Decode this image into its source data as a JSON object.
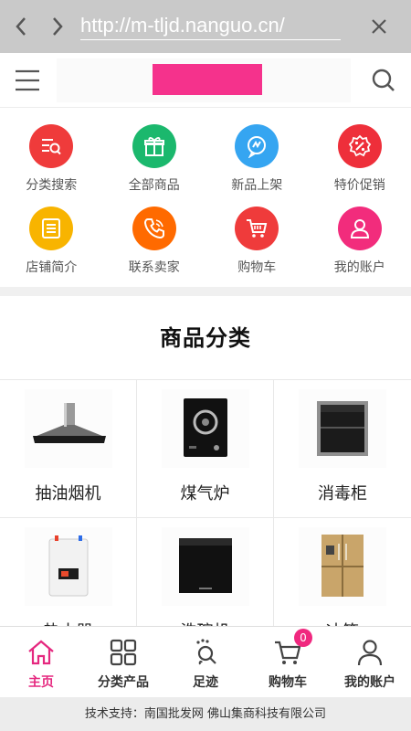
{
  "browser": {
    "url": "http://m-tljd.nanguo.cn/"
  },
  "header": {
    "logo_color": "#f5328c"
  },
  "quick_links": [
    {
      "label": "分类搜索",
      "icon": "category-search-icon",
      "color": "#ef3b3b"
    },
    {
      "label": "全部商品",
      "icon": "gift-icon",
      "color": "#1bb86d"
    },
    {
      "label": "新品上架",
      "icon": "new-product-icon",
      "color": "#35a5f1"
    },
    {
      "label": "特价促销",
      "icon": "discount-icon",
      "color": "#ee2f3a"
    },
    {
      "label": "店铺简介",
      "icon": "store-info-icon",
      "color": "#f8b400"
    },
    {
      "label": "联系卖家",
      "icon": "phone-icon",
      "color": "#ff6a00"
    },
    {
      "label": "购物车",
      "icon": "cart-icon",
      "color": "#ef3b3b"
    },
    {
      "label": "我的账户",
      "icon": "user-icon",
      "color": "#f22c7c"
    }
  ],
  "section_title": "商品分类",
  "categories": [
    {
      "label": "抽油烟机",
      "icon": "range-hood-image"
    },
    {
      "label": "煤气炉",
      "icon": "gas-stove-image"
    },
    {
      "label": "消毒柜",
      "icon": "disinfection-cabinet-image"
    },
    {
      "label": "热水器",
      "icon": "water-heater-image"
    },
    {
      "label": "洗碗机",
      "icon": "dishwasher-image"
    },
    {
      "label": "冰箱",
      "icon": "refrigerator-image"
    }
  ],
  "bottom_nav": [
    {
      "label": "主页",
      "icon": "home-icon",
      "active": true
    },
    {
      "label": "分类产品",
      "icon": "grid-icon",
      "active": false
    },
    {
      "label": "足迹",
      "icon": "footprint-icon",
      "active": false
    },
    {
      "label": "购物车",
      "icon": "cart-icon",
      "active": false,
      "badge": "0"
    },
    {
      "label": "我的账户",
      "icon": "user-icon",
      "active": false
    }
  ],
  "footer": "技术支持：南国批发网   佛山集商科技有限公司",
  "colors": {
    "accent": "#e5287f",
    "browser_bar": "#c9c9c9"
  }
}
